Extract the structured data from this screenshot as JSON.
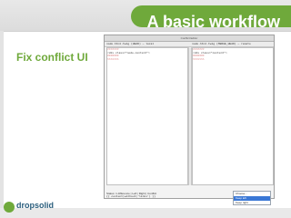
{
  "slide": {
    "title": "A basic workflow",
    "section_label": "Fix conflict UI",
    "logo_text": "dropsolid"
  },
  "app": {
    "window_title": "Conflict Editor",
    "left_header": "node.html.twig (HEAD) — local",
    "right_header": "node.html.twig (MERGE_HEAD) — remote",
    "left_lines": [
      "<<<<<<<",
      "  <div class=\"node-content\">",
      "=======",
      ">>>>>>>"
    ],
    "right_lines": [
      "<<<<<<<",
      "  <div class=\"content\">",
      "=======",
      ">>>>>>>"
    ],
    "status_text": "Status: 1 difference  |  Left  |  Right  |  Conflict",
    "bottom_code": "{{ content|without('links') }}"
  },
  "dropdown": {
    "items": [
      "Choose...",
      "Keep left",
      "Keep right"
    ]
  },
  "colors": {
    "accent": "#6fa93b",
    "selection": "#3a78d6"
  }
}
